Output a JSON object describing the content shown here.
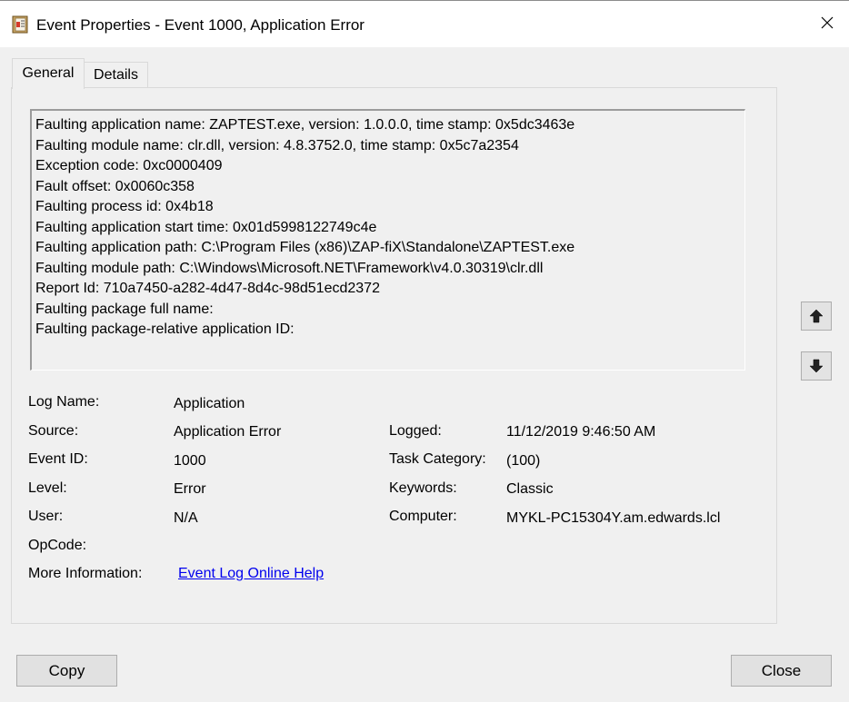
{
  "window": {
    "title": "Event Properties - Event 1000, Application Error",
    "icon": "event-viewer-icon"
  },
  "tabs": [
    {
      "label": "General",
      "selected": true
    },
    {
      "label": "Details",
      "selected": false
    }
  ],
  "description_lines": [
    "Faulting application name: ZAPTEST.exe, version: 1.0.0.0, time stamp: 0x5dc3463e",
    "Faulting module name: clr.dll, version: 4.8.3752.0, time stamp: 0x5c7a2354",
    "Exception code: 0xc0000409",
    "Fault offset: 0x0060c358",
    "Faulting process id: 0x4b18",
    "Faulting application start time: 0x01d5998122749c4e",
    "Faulting application path: C:\\Program Files (x86)\\ZAP-fiX\\Standalone\\ZAPTEST.exe",
    "Faulting module path: C:\\Windows\\Microsoft.NET\\Framework\\v4.0.30319\\clr.dll",
    "Report Id: 710a7450-a282-4d47-8d4c-98d51ecd2372",
    "Faulting package full name:",
    "Faulting package-relative application ID:"
  ],
  "fields": {
    "log_name": {
      "label": "Log Name:",
      "value": "Application"
    },
    "source": {
      "label": "Source:",
      "value": "Application Error"
    },
    "event_id": {
      "label": "Event ID:",
      "value": "1000"
    },
    "level": {
      "label": "Level:",
      "value": "Error"
    },
    "user": {
      "label": "User:",
      "value": "N/A"
    },
    "opcode": {
      "label": "OpCode:",
      "value": ""
    },
    "more_info": {
      "label": "More Information:",
      "link_text": "Event Log Online Help"
    },
    "logged": {
      "label": "Logged:",
      "value": "11/12/2019 9:46:50 AM"
    },
    "task_category": {
      "label": "Task Category:",
      "value": "(100)"
    },
    "keywords": {
      "label": "Keywords:",
      "value": "Classic"
    },
    "computer": {
      "label": "Computer:",
      "value": "MYKL-PC15304Y.am.edwards.lcl"
    }
  },
  "buttons": {
    "copy": "Copy",
    "close": "Close"
  },
  "colors": {
    "window_bg": "#f0f0f0",
    "titlebar_bg": "#ffffff",
    "link": "#0000ee",
    "button_bg": "#e1e1e1",
    "button_border": "#adadad"
  }
}
